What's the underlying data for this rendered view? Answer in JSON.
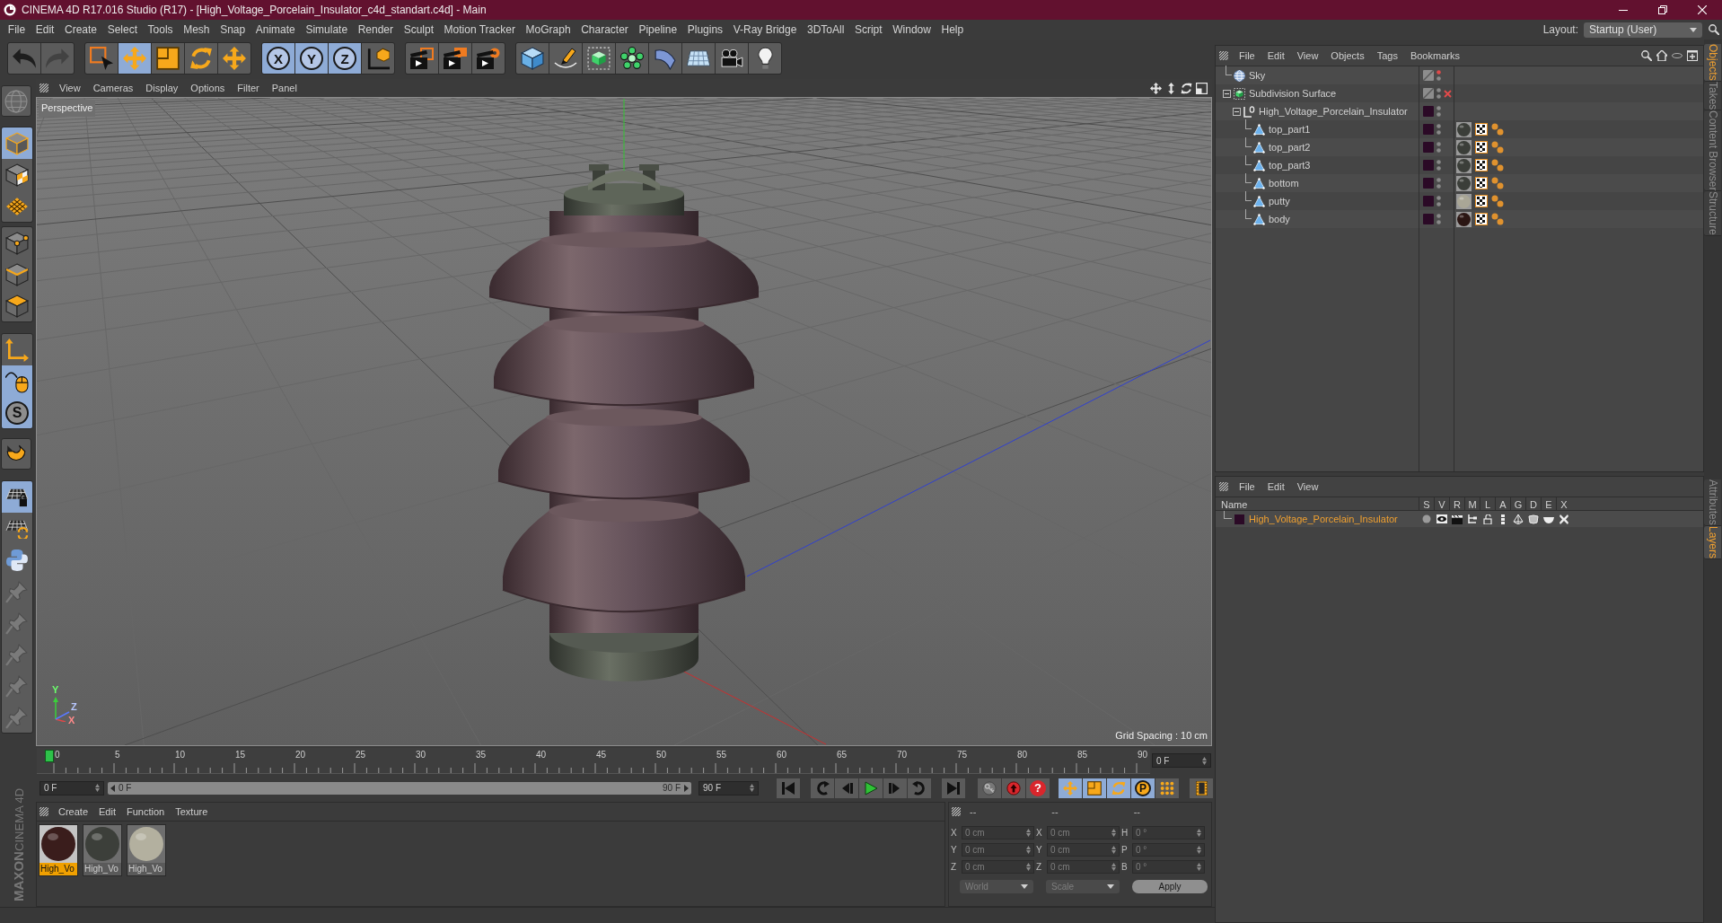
{
  "window": {
    "title": "CINEMA 4D R17.016 Studio (R17) - [High_Voltage_Porcelain_Insulator_c4d_standart.c4d] - Main"
  },
  "menu_bar": {
    "items": [
      "File",
      "Edit",
      "Create",
      "Select",
      "Tools",
      "Mesh",
      "Snap",
      "Animate",
      "Simulate",
      "Render",
      "Sculpt",
      "Motion Tracker",
      "MoGraph",
      "Character",
      "Pipeline",
      "Plugins",
      "V-Ray Bridge",
      "3DToAll",
      "Script",
      "Window",
      "Help"
    ],
    "layout_label": "Layout:",
    "layout_value": "Startup (User)"
  },
  "toolbar": {
    "groups": [
      [
        {
          "kind": "undo",
          "selected": false,
          "disabled": false
        },
        {
          "kind": "redo",
          "selected": false,
          "disabled": true
        }
      ],
      [
        {
          "kind": "live_select",
          "selected": false
        },
        {
          "kind": "move",
          "selected": true
        },
        {
          "kind": "scale",
          "selected": false
        },
        {
          "kind": "rotate",
          "selected": false
        },
        {
          "kind": "recent_tool",
          "selected": false
        }
      ],
      [
        {
          "kind": "axis_lock",
          "label": "X",
          "selected": true
        },
        {
          "kind": "axis_lock",
          "label": "Y",
          "selected": true
        },
        {
          "kind": "axis_lock",
          "label": "Z",
          "selected": true
        },
        {
          "kind": "coordinate_system",
          "selected": false
        }
      ],
      [
        {
          "kind": "render_view",
          "selected": false
        },
        {
          "kind": "render_picture",
          "selected": false
        },
        {
          "kind": "render_settings",
          "selected": false
        }
      ],
      [
        {
          "kind": "cube",
          "selected": false
        },
        {
          "kind": "pen",
          "selected": false
        },
        {
          "kind": "subdivision",
          "selected": false
        },
        {
          "kind": "cloner",
          "selected": false
        },
        {
          "kind": "deformer",
          "selected": false
        },
        {
          "kind": "floor",
          "selected": false
        },
        {
          "kind": "camera",
          "selected": false
        },
        {
          "kind": "light",
          "selected": false
        }
      ]
    ]
  },
  "left_toolbar": {
    "groups": [
      [
        {
          "kind": "globe",
          "selected": false,
          "disabled": true
        }
      ],
      [
        {
          "kind": "model",
          "selected": true
        },
        {
          "kind": "texture",
          "selected": false
        },
        {
          "kind": "workplane",
          "selected": false
        }
      ],
      [
        {
          "kind": "points",
          "selected": false
        },
        {
          "kind": "edges",
          "selected": false
        },
        {
          "kind": "polygons",
          "selected": false
        }
      ],
      [
        {
          "kind": "axis",
          "selected": false
        },
        {
          "kind": "tweak",
          "selected": true
        },
        {
          "kind": "solo",
          "label": "S",
          "selected": true
        }
      ],
      [
        {
          "kind": "magnet",
          "selected": false
        }
      ],
      [
        {
          "kind": "workplane_lock",
          "selected": true,
          "disabled": false
        },
        {
          "kind": "workplane_align",
          "selected": false,
          "disabled": false
        },
        {
          "kind": "python",
          "selected": false,
          "disabled": false
        },
        {
          "kind": "pin",
          "selected": false,
          "disabled": true
        },
        {
          "kind": "pin",
          "selected": false,
          "disabled": true
        },
        {
          "kind": "pin",
          "selected": false,
          "disabled": true
        },
        {
          "kind": "pin",
          "selected": false,
          "disabled": true
        },
        {
          "kind": "pin",
          "selected": false,
          "disabled": true
        }
      ]
    ]
  },
  "viewport": {
    "menu": [
      "View",
      "Cameras",
      "Display",
      "Options",
      "Filter",
      "Panel"
    ],
    "camera": "Perspective",
    "grid_spacing": "Grid Spacing : 10 cm",
    "gizmo_labels": [
      "Y",
      "Z",
      "X"
    ]
  },
  "timeline": {
    "ticks": [
      "0",
      "5",
      "10",
      "15",
      "20",
      "25",
      "30",
      "35",
      "40",
      "45",
      "50",
      "55",
      "60",
      "65",
      "70",
      "75",
      "80",
      "85",
      "90"
    ],
    "playhead": {
      "level": 0
    },
    "frame_field": "0 F"
  },
  "transport": {
    "start_field": "0 F",
    "range": {
      "start": "0 F",
      "end": "90 F",
      "level": 1
    },
    "end_field": "90 F",
    "buttons": [
      {
        "kind": "go_start",
        "selected": false
      },
      {
        "kind": "prev_key",
        "selected": false
      },
      {
        "kind": "prev_frame",
        "selected": false
      },
      {
        "kind": "play",
        "selected": false
      },
      {
        "kind": "next_frame",
        "selected": false
      },
      {
        "kind": "next_key",
        "selected": false
      },
      {
        "kind": "go_end",
        "selected": false
      },
      {
        "kind": "record_key",
        "selected": false
      },
      {
        "kind": "record",
        "selected": false
      },
      {
        "kind": "autokey",
        "label": "?",
        "selected": false
      },
      {
        "kind": "key_position",
        "selected": true
      },
      {
        "kind": "key_scale",
        "selected": true
      },
      {
        "kind": "key_rotation",
        "selected": true
      },
      {
        "kind": "key_parameter",
        "label": "P",
        "selected": true
      },
      {
        "kind": "key_points",
        "selected": false
      },
      {
        "kind": "timeline",
        "selected": false
      }
    ]
  },
  "materials": {
    "menu": [
      "Create",
      "Edit",
      "Function",
      "Texture"
    ],
    "items": [
      {
        "label": "High_Vo",
        "color": "#3a1d1c",
        "selected": true
      },
      {
        "label": "High_Vo",
        "color": "#3c3f3a",
        "selected": false
      },
      {
        "label": "High_Vo",
        "color": "#b3b09f",
        "selected": false
      }
    ]
  },
  "coordinates": {
    "headers": [
      "--",
      "--",
      "--"
    ],
    "rows": [
      [
        {
          "axis": "X",
          "value": "0 cm"
        },
        {
          "axis": "X",
          "value": "0 cm"
        },
        {
          "axis": "H",
          "value": "0 °"
        }
      ],
      [
        {
          "axis": "Y",
          "value": "0 cm"
        },
        {
          "axis": "Y",
          "value": "0 cm"
        },
        {
          "axis": "P",
          "value": "0 °"
        }
      ],
      [
        {
          "axis": "Z",
          "value": "0 cm"
        },
        {
          "axis": "Z",
          "value": "0 cm"
        },
        {
          "axis": "B",
          "value": "0 °"
        }
      ]
    ],
    "mode": "World",
    "size_mode": "Scale",
    "apply": "Apply"
  },
  "object_manager": {
    "menu": [
      "File",
      "Edit",
      "View",
      "Objects",
      "Tags",
      "Bookmarks"
    ],
    "objects": [
      {
        "name": "Sky",
        "kind": "sky",
        "layer": false,
        "editor_hidden": true
      },
      {
        "name": "Subdivision Surface",
        "kind": "subdivision",
        "layer": false,
        "editor_hidden": false,
        "enabled": false,
        "expanded": true,
        "children": [
          {
            "name": "High_Voltage_Porcelain_Insulator",
            "kind": "null",
            "layer": true,
            "editor_hidden": false,
            "expanded": true,
            "children": [
              {
                "name": "top_part1",
                "kind": "polygon",
                "layer": true,
                "editor_hidden": false,
                "tags": [
                  {
                    "kind": "material",
                    "color": "#3b3e39"
                  },
                  {
                    "kind": "checker"
                  },
                  {
                    "kind": "dots"
                  }
                ]
              },
              {
                "name": "top_part2",
                "kind": "polygon",
                "layer": true,
                "editor_hidden": false,
                "tags": [
                  {
                    "kind": "material",
                    "color": "#3b3e39"
                  },
                  {
                    "kind": "checker"
                  },
                  {
                    "kind": "dots"
                  }
                ]
              },
              {
                "name": "top_part3",
                "kind": "polygon",
                "layer": true,
                "editor_hidden": false,
                "tags": [
                  {
                    "kind": "material",
                    "color": "#3b3e39"
                  },
                  {
                    "kind": "checker"
                  },
                  {
                    "kind": "dots"
                  }
                ]
              },
              {
                "name": "bottom",
                "kind": "polygon",
                "layer": true,
                "editor_hidden": false,
                "tags": [
                  {
                    "kind": "material",
                    "color": "#3b3e39"
                  },
                  {
                    "kind": "checker"
                  },
                  {
                    "kind": "dots"
                  }
                ]
              },
              {
                "name": "putty",
                "kind": "polygon",
                "layer": true,
                "editor_hidden": false,
                "tags": [
                  {
                    "kind": "material",
                    "color": "#a9a696"
                  },
                  {
                    "kind": "checker"
                  },
                  {
                    "kind": "dots"
                  }
                ]
              },
              {
                "name": "body",
                "kind": "polygon",
                "layer": true,
                "editor_hidden": false,
                "tags": [
                  {
                    "kind": "material",
                    "color": "#2b1613"
                  },
                  {
                    "kind": "checker"
                  },
                  {
                    "kind": "dots"
                  }
                ]
              }
            ]
          }
        ]
      }
    ]
  },
  "layer_manager": {
    "menu": [
      "File",
      "Edit",
      "View"
    ],
    "columns": [
      "Name",
      "S",
      "V",
      "R",
      "M",
      "L",
      "A",
      "G",
      "D",
      "E",
      "X"
    ],
    "layers": [
      {
        "name": "High_Voltage_Porcelain_Insulator",
        "color": "#2b0a26",
        "selected": true
      }
    ]
  },
  "side_tabs": {
    "upper": [
      {
        "label": "Objects",
        "selected": true
      },
      {
        "label": "Takes",
        "selected": false
      },
      {
        "label": "Content Browser",
        "selected": false
      },
      {
        "label": "Structure",
        "selected": false
      }
    ],
    "lower": [
      {
        "label": "Attributes",
        "selected": false
      },
      {
        "label": "Layers",
        "selected": true
      }
    ]
  },
  "logo": {
    "brand": "MAXON",
    "product": "CINEMA 4D"
  }
}
